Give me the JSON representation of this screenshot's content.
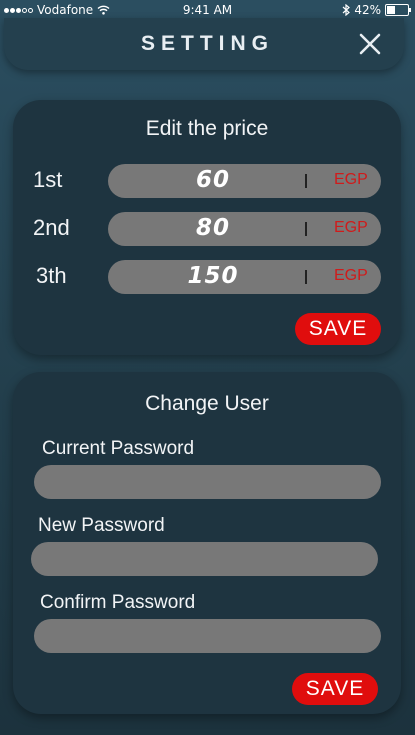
{
  "status_bar": {
    "carrier": "Vodafone",
    "time": "9:41 AM",
    "battery": "42%",
    "battery_level": 0.42,
    "signal_bars_filled": 3,
    "signal_bars_total": 5
  },
  "header": {
    "title": "SETTING",
    "close_icon": "close-icon"
  },
  "price_card": {
    "title": "Edit the price",
    "rows": [
      {
        "label": "1st",
        "value": "60",
        "unit": "EGP"
      },
      {
        "label": "2nd",
        "value": "80",
        "unit": "EGP"
      },
      {
        "label": "3th",
        "value": "150",
        "unit": "EGP"
      }
    ],
    "save_label": "SAVE"
  },
  "user_card": {
    "title": "Change User",
    "fields": [
      {
        "label": "Current Password",
        "value": ""
      },
      {
        "label": "New Password",
        "value": ""
      },
      {
        "label": "Confirm Password",
        "value": ""
      }
    ],
    "save_label": "SAVE"
  },
  "colors": {
    "accent": "#e00d0d",
    "field": "#787878",
    "card": "#1e3440",
    "unit_text": "#d01b1b"
  }
}
